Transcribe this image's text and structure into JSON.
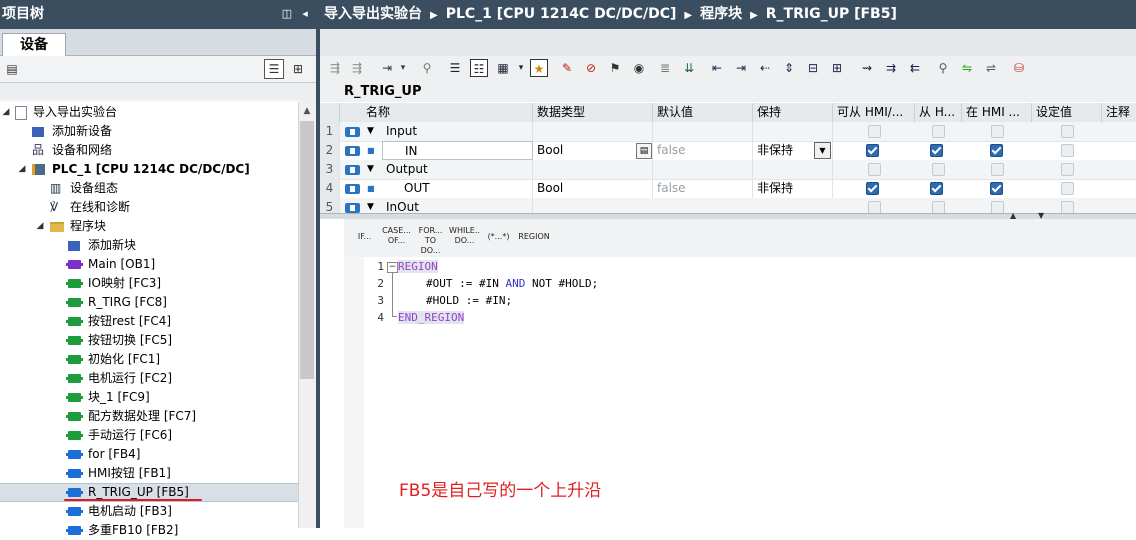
{
  "project_tree": {
    "title": "项目树",
    "tab": "设备",
    "items": [
      {
        "label": "导入导出实验台"
      },
      {
        "label": "添加新设备"
      },
      {
        "label": "设备和网络"
      },
      {
        "label": "PLC_1 [CPU 1214C DC/DC/DC]"
      },
      {
        "label": "设备组态"
      },
      {
        "label": "在线和诊断"
      },
      {
        "label": "程序块"
      },
      {
        "label": "添加新块"
      },
      {
        "label": "Main [OB1]"
      },
      {
        "label": "IO映射 [FC3]"
      },
      {
        "label": "R_TIRG [FC8]"
      },
      {
        "label": "按钮rest [FC4]"
      },
      {
        "label": "按钮切换 [FC5]"
      },
      {
        "label": "初始化 [FC1]"
      },
      {
        "label": "电机运行 [FC2]"
      },
      {
        "label": "块_1 [FC9]"
      },
      {
        "label": "配方数据处理 [FC7]"
      },
      {
        "label": "手动运行 [FC6]"
      },
      {
        "label": "for [FB4]"
      },
      {
        "label": "HMI按钮 [FB1]"
      },
      {
        "label": "R_TRIG_UP [FB5]"
      },
      {
        "label": "电机启动 [FB3]"
      },
      {
        "label": "多重FB10 [FB2]"
      }
    ]
  },
  "breadcrumb": [
    "导入导出实验台",
    "PLC_1 [CPU 1214C DC/DC/DC]",
    "程序块",
    "R_TRIG_UP [FB5]"
  ],
  "block_name": "R_TRIG_UP",
  "interface": {
    "columns": [
      "名称",
      "数据类型",
      "默认值",
      "保持",
      "可从 HMI/...",
      "从 H...",
      "在 HMI ...",
      "设定值",
      "注释"
    ],
    "rows": [
      {
        "num": "1",
        "name": "Input",
        "type": "",
        "default": "",
        "retain": ""
      },
      {
        "num": "2",
        "name": "IN",
        "type": "Bool",
        "default": "false",
        "retain": "非保持"
      },
      {
        "num": "3",
        "name": "Output",
        "type": "",
        "default": "",
        "retain": ""
      },
      {
        "num": "4",
        "name": "OUT",
        "type": "Bool",
        "default": "false",
        "retain": "非保持"
      },
      {
        "num": "5",
        "name": "InOut",
        "type": "",
        "default": "",
        "retain": ""
      }
    ]
  },
  "scl_buttons": [
    {
      "line1": "IF...",
      "line2": ""
    },
    {
      "line1": "CASE...",
      "line2": "OF..."
    },
    {
      "line1": "FOR...",
      "line2": "TO DO..."
    },
    {
      "line1": "WHILE..",
      "line2": "DO..."
    },
    {
      "line1": "(*...*)",
      "line2": ""
    },
    {
      "line1": "REGION",
      "line2": ""
    }
  ],
  "code": {
    "line_numbers": [
      "1",
      "2",
      "3",
      "4"
    ],
    "l1": "REGION",
    "l2_a": "#OUT := #IN ",
    "l2_kw1": "AND",
    "l2_b": " NOT #HOLD;",
    "l3": "#HOLD := #IN;",
    "l4": "END_REGION"
  },
  "annotation": "FB5是自己写的一个上升沿"
}
